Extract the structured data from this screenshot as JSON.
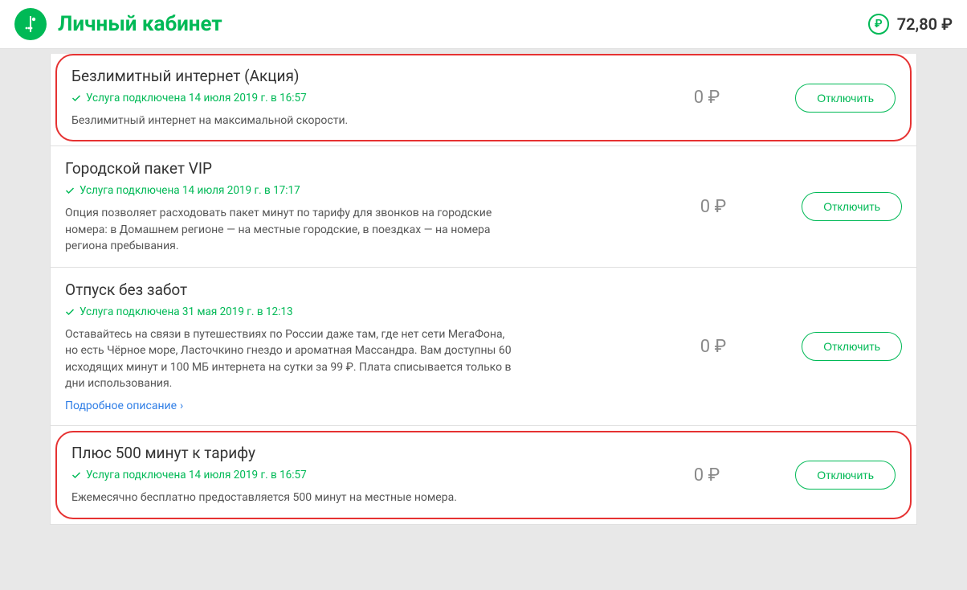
{
  "header": {
    "title": "Личный кабинет",
    "balance": "72,80 ₽"
  },
  "services": [
    {
      "title": "Безлимитный интернет (Акция)",
      "status": "Услуга подключена 14 июля 2019 г. в 16:57",
      "desc": "Безлимитный интернет на максимальной скорости.",
      "price": "0 ₽",
      "action": "Отключить",
      "highlight": true
    },
    {
      "title": "Городской пакет VIP",
      "status": "Услуга подключена 14 июля 2019 г. в 17:17",
      "desc": "Опция позволяет расходовать пакет минут по тарифу для звонков на городские номера: в Домашнем регионе — на местные городские, в поездках — на номера региона пребывания.",
      "price": "0 ₽",
      "action": "Отключить",
      "highlight": false
    },
    {
      "title": "Отпуск без забот",
      "status": "Услуга подключена 31 мая 2019 г. в 12:13",
      "desc": "Оставайтесь на связи в путешествиях по России даже там, где нет сети МегаФона, но есть Чёрное море, Ласточкино гнездо и ароматная Массандра. Вам доступны 60 исходящих минут и 100 МБ интернета на сутки за 99 ₽. Плата списывается только в дни использования.",
      "price": "0 ₽",
      "action": "Отключить",
      "details": "Подробное описание",
      "highlight": false
    },
    {
      "title": "Плюс 500 минут к тарифу",
      "status": "Услуга подключена 14 июля 2019 г. в 16:57",
      "desc": "Ежемесячно бесплатно предоставляется 500 минут на местные номера.",
      "price": "0 ₽",
      "action": "Отключить",
      "highlight": true
    }
  ]
}
